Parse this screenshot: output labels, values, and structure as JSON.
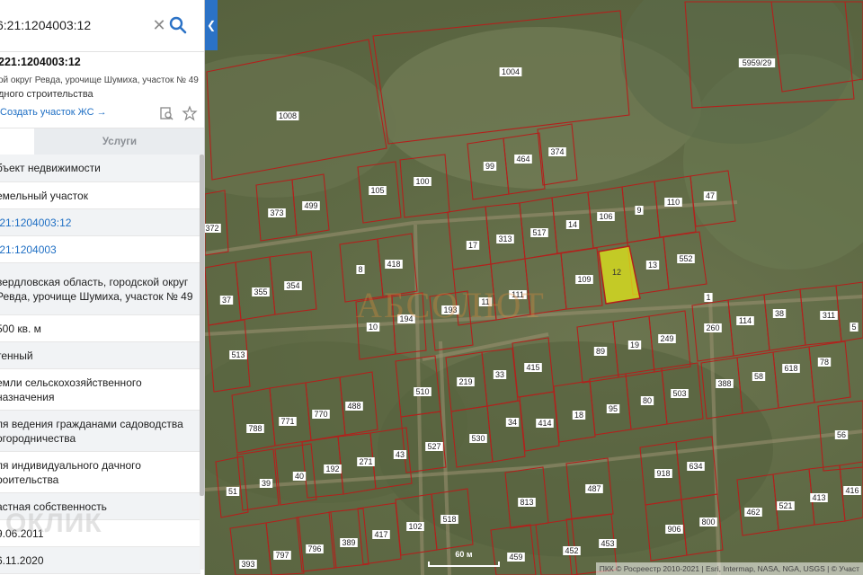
{
  "search": {
    "value": "6:21:1204003:12"
  },
  "parcel": {
    "title": "221:1204003:12",
    "address_short": "ой округ Ревда, урочище Шумиха, участок № 49",
    "purpose_short": "дного строительства",
    "create_link": "Создать участок ЖС →"
  },
  "tabs": {
    "services": "Услуги"
  },
  "rows": [
    {
      "text": "бъект недвижимости",
      "alt": true,
      "link": false
    },
    {
      "text": "емельный участок",
      "alt": false,
      "link": false
    },
    {
      "text": ":21:1204003:12",
      "alt": true,
      "link": true
    },
    {
      "text": ":21:1204003",
      "alt": false,
      "link": true
    },
    {
      "text": "вердловская область, городской округ Ревда, урочище Шумиха, участок № 49",
      "alt": true,
      "link": false
    },
    {
      "text": "500 кв. м",
      "alt": false,
      "link": false
    },
    {
      "text": "тенный",
      "alt": true,
      "link": false
    },
    {
      "text": "емли сельскохозяйственного назначения",
      "alt": false,
      "link": false
    },
    {
      "text": "ля ведения гражданами садоводства огородничества",
      "alt": true,
      "link": false
    },
    {
      "text": "ля индивидуального дачного роительства",
      "alt": false,
      "link": false
    },
    {
      "text": "астная собственность",
      "alt": true,
      "link": false
    },
    {
      "text": "9.06.2011",
      "alt": false,
      "link": false
    },
    {
      "text": "6.11.2020",
      "alt": true,
      "link": false
    }
  ],
  "watermark": {
    "left": "ОКЛИК",
    "map": "АБСОЛЮТ"
  },
  "map": {
    "attribution": "ПКК © Росреестр 2010-2021 | Esri, Intermap, NASA, NGA, USGS | © Участ",
    "scale_label": "60 м",
    "selected_label": "12",
    "labels": [
      "1004",
      "1008",
      "5959/29",
      "99",
      "464",
      "374",
      "105",
      "100",
      "110",
      "47",
      "373",
      "499",
      "372",
      "106",
      "9",
      "17",
      "313",
      "517",
      "14",
      "13",
      "552",
      "8",
      "418",
      "37",
      "355",
      "354",
      "109",
      "11",
      "111",
      "193",
      "10",
      "194",
      "513",
      "1",
      "260",
      "114",
      "38",
      "311",
      "89",
      "19",
      "249",
      "415",
      "219",
      "33",
      "510",
      "618",
      "78",
      "5",
      "388",
      "58",
      "503",
      "80",
      "95",
      "18",
      "414",
      "788",
      "771",
      "770",
      "488",
      "34",
      "530",
      "527",
      "43",
      "271",
      "192",
      "40",
      "39",
      "51",
      "56",
      "918",
      "634",
      "813",
      "487",
      "462",
      "521",
      "413",
      "416",
      "906",
      "800",
      "102",
      "518",
      "453",
      "452",
      "459",
      "417",
      "389",
      "796",
      "797",
      "393"
    ]
  },
  "colors": {
    "accent": "#2b72c6",
    "link": "#1f6fc4",
    "parcel_border": "#b3201c",
    "selected_fill": "#e3e81a"
  }
}
